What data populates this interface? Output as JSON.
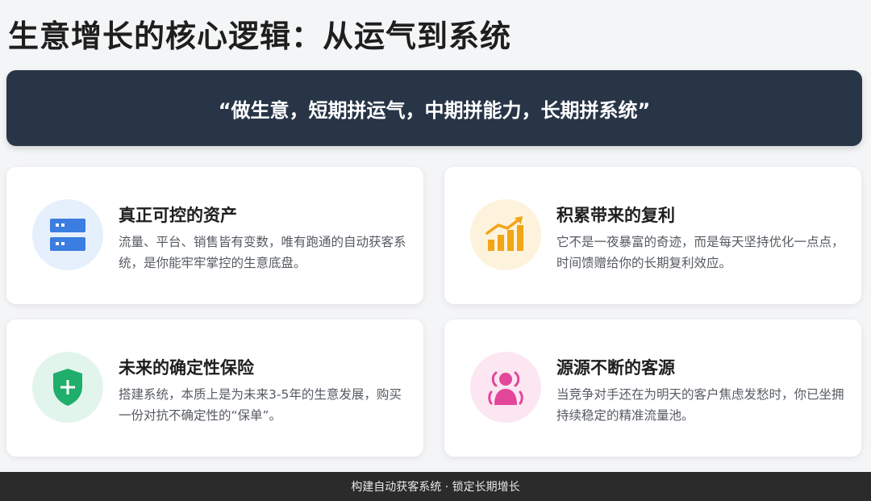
{
  "title": "生意增长的核心逻辑：从运气到系统",
  "quote": "“做生意，短期拼运气，中期拼能力，长期拼系统”",
  "cards": [
    {
      "title": "真正可控的资产",
      "desc": "流量、平台、销售皆有变数，唯有跑通的自动获客系统，是你能牢牢掌控的生意底盘。",
      "icon": "server-icon",
      "icon_color": "#3b7de0",
      "icon_bg": "#e6effc"
    },
    {
      "title": "积累带来的复利",
      "desc": "它不是一夜暴富的奇迹，而是每天坚持优化一点点，时间馈赠给你的长期复利效应。",
      "icon": "growth-chart-icon",
      "icon_color": "#f2a516",
      "icon_bg": "#fdf2dc"
    },
    {
      "title": "未来的确定性保险",
      "desc": "搭建系统，本质上是为未来3-5年的生意发展，购买一份对抗不确定性的“保单”。",
      "icon": "shield-plus-icon",
      "icon_color": "#1fae6b",
      "icon_bg": "#e2f5ec"
    },
    {
      "title": "源源不断的客源",
      "desc": "当竞争对手还在为明天的客户焦虑发愁时，你已坐拥持续稳定的精准流量池。",
      "icon": "person-broadcast-icon",
      "icon_color": "#e2479a",
      "icon_bg": "#fce6f1"
    }
  ],
  "footer": "构建自动获客系统 · 锁定长期增长"
}
